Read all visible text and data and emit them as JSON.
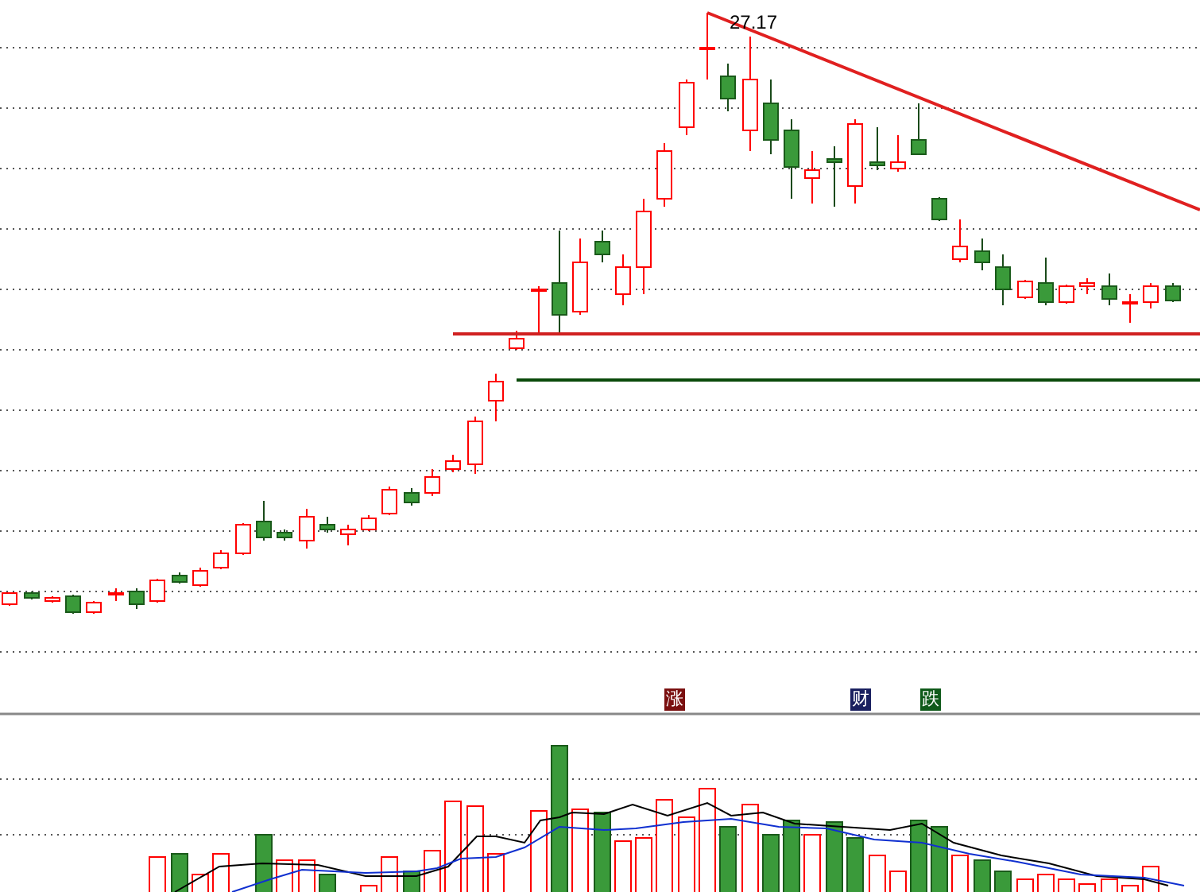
{
  "price_chart": {
    "peak_label": "27.17"
  },
  "event_markers": [
    {
      "label": "涨",
      "kind": "rise"
    },
    {
      "label": "财",
      "kind": "finance"
    },
    {
      "label": "跌",
      "kind": "fall"
    }
  ]
}
